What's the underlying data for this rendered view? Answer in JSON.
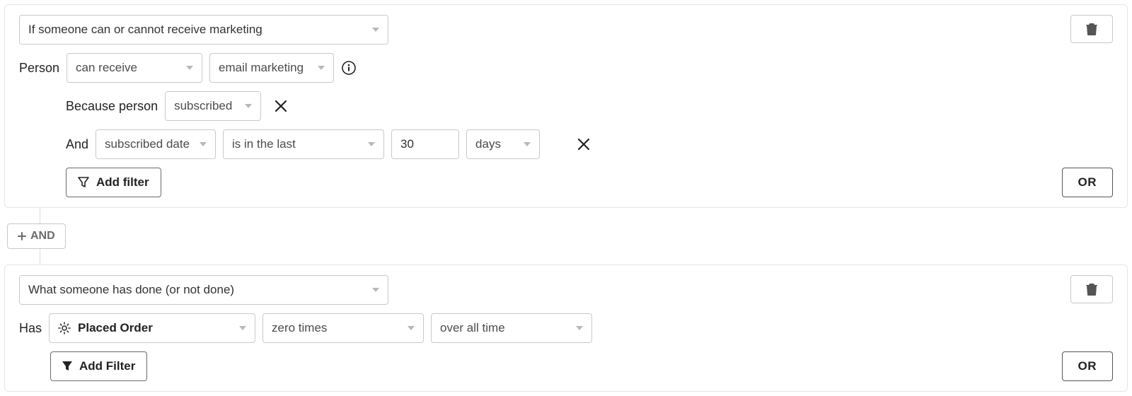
{
  "group1": {
    "conditionType": "If someone can or cannot receive marketing",
    "person": {
      "label": "Person",
      "canReceive": "can receive",
      "channel": "email marketing"
    },
    "because": {
      "label": "Because person",
      "reason": "subscribed"
    },
    "andRow": {
      "label": "And",
      "field": "subscribed date",
      "operator": "is in the last",
      "value": "30",
      "unit": "days"
    },
    "addFilter": "Add filter",
    "or": "OR"
  },
  "connector": {
    "and": "AND"
  },
  "group2": {
    "conditionType": "What someone has done (or not done)",
    "has": {
      "label": "Has",
      "metric": "Placed Order",
      "count": "zero times",
      "timeframe": "over all time"
    },
    "addFilter": "Add Filter",
    "or": "OR"
  }
}
